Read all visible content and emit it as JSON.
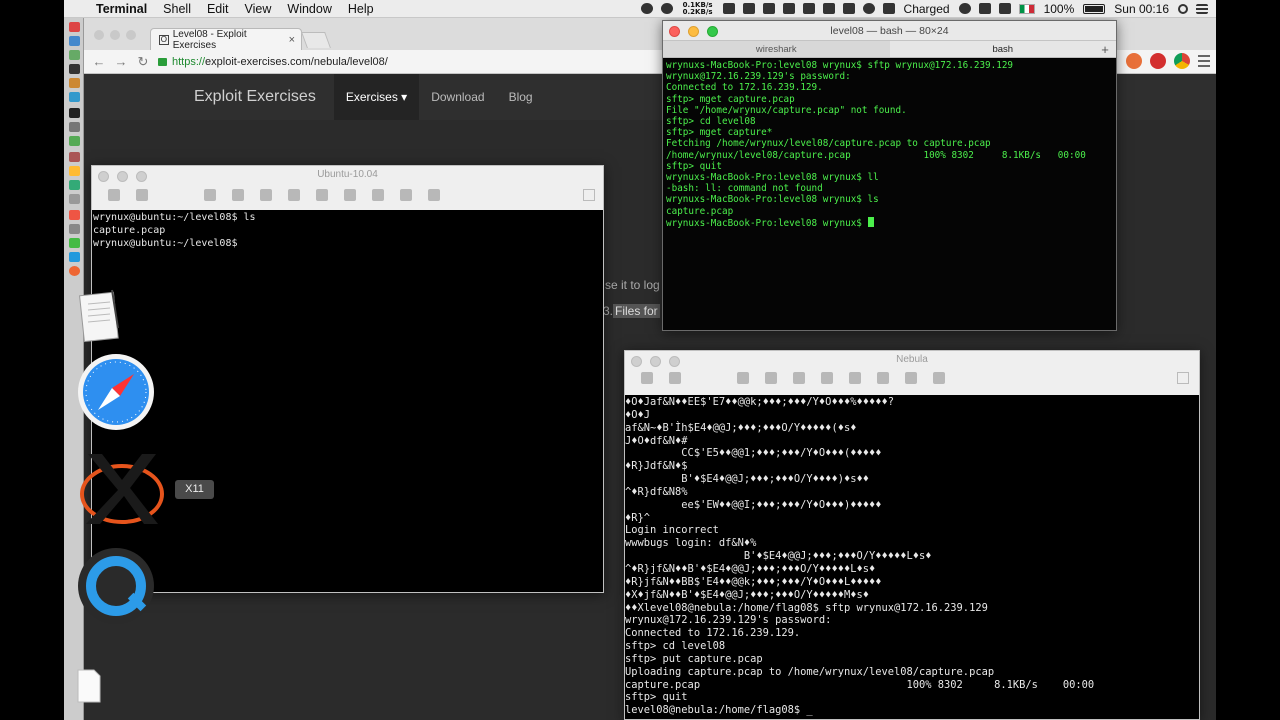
{
  "menubar": {
    "app_name": "Terminal",
    "menus": [
      "Shell",
      "Edit",
      "View",
      "Window",
      "Help"
    ],
    "net_up": "0.1KB/s",
    "net_down": "0.2KB/s",
    "battery_status": "Charged",
    "battery_percent": "100%",
    "clock": "Sun 00:16"
  },
  "browser": {
    "tab_title": "Level08 - Exploit Exercises",
    "tab_favicon": "O",
    "tab_close": "×",
    "url_scheme": "https://",
    "url_rest": "exploit-exercises.com/nebula/level08/",
    "site": {
      "brand": "Exploit Exercises",
      "nav": [
        "Exercises ▾",
        "Download",
        "Blog"
      ],
      "frag_use": "se it to log",
      "frag_files_prefix": "3.",
      "frag_files": "Files for"
    }
  },
  "ubuntu_vm": {
    "title": "Ubuntu-10.04",
    "lines": [
      "wrynux@ubuntu:~/level08$ ls",
      "capture.pcap",
      "wrynux@ubuntu:~/level08$"
    ]
  },
  "mac_terminal": {
    "title": "level08 — bash — 80×24",
    "tabs": [
      "wireshark",
      "bash"
    ],
    "plus": "+",
    "lines": [
      "wrynuxs-MacBook-Pro:level08 wrynux$ sftp wrynux@172.16.239.129",
      "wrynux@172.16.239.129's password:",
      "Connected to 172.16.239.129.",
      "sftp> mget capture.pcap",
      "File \"/home/wrynux/capture.pcap\" not found.",
      "sftp> cd level08",
      "sftp> mget capture*",
      "Fetching /home/wrynux/level08/capture.pcap to capture.pcap",
      "/home/wrynux/level08/capture.pcap             100% 8302     8.1KB/s   00:00",
      "sftp> quit",
      "wrynuxs-MacBook-Pro:level08 wrynux$ ll",
      "-bash: ll: command not found",
      "wrynuxs-MacBook-Pro:level08 wrynux$ ls",
      "capture.pcap",
      "wrynuxs-MacBook-Pro:level08 wrynux$ "
    ]
  },
  "nebula_vm": {
    "title": "Nebula",
    "lines": [
      "♦O♦Jaf&N♦♦EE$'E7♦♦@@k;♦♦♦;♦♦♦/Y♦O♦♦♦%♦♦♦♦♦?",
      "♦O♦J",
      "af&N~♦B'Ìh$E4♦@@J;♦♦♦;♦♦♦O/Y♦♦♦♦♦(♦s♦",
      "J♦O♦df&N♦#",
      "         CC$'E5♦♦@@1;♦♦♦;♦♦♦/Y♦O♦♦♦(♦♦♦♦♦",
      "♦R}Jdf&N♦$",
      "         B'♦$E4♦@@J;♦♦♦;♦♦♦O/Y♦♦♦♦)♦s♦♦",
      "^♦R}df&N8%",
      "         ee$'EW♦♦@@I;♦♦♦;♦♦♦/Y♦O♦♦♦)♦♦♦♦♦",
      "♦R}^",
      "Login incorrect",
      "wwwbugs login: df&N♦%",
      "                   B'♦$E4♦@@J;♦♦♦;♦♦♦O/Y♦♦♦♦♦L♦s♦",
      "^♦R}jf&N♦♦B'♦$E4♦@@J;♦♦♦;♦♦♦O/Y♦♦♦♦♦L♦s♦",
      "♦R}jf&N♦♦BB$'E4♦♦@@k;♦♦♦;♦♦♦/Y♦O♦♦♦L♦♦♦♦♦",
      "♦X♦jf&N♦♦B'♦$E4♦@@J;♦♦♦;♦♦♦O/Y♦♦♦♦♦M♦s♦",
      "♦♦Xlevel08@nebula:/home/flag08$ sftp wrynux@172.16.239.129",
      "wrynux@172.16.239.129's password:",
      "Connected to 172.16.239.129.",
      "sftp> cd level08",
      "sftp> put capture.pcap",
      "Uploading capture.pcap to /home/wrynux/level08/capture.pcap",
      "capture.pcap                                 100% 8302     8.1KB/s    00:00",
      "sftp> quit",
      "level08@nebula:/home/flag08$ _"
    ]
  },
  "dock": {
    "x11_tooltip": "X11",
    "icons": [
      "textedit-icon",
      "safari-icon",
      "x11-icon",
      "quicktime-icon",
      "document-icon"
    ]
  }
}
